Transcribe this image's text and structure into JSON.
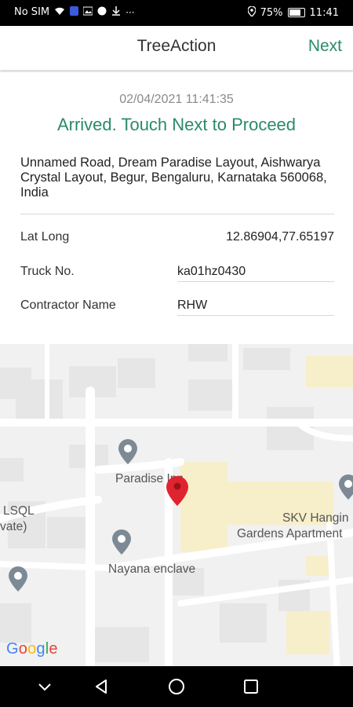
{
  "status_bar": {
    "carrier": "No SIM",
    "battery": "75%",
    "time": "11:41"
  },
  "app_bar": {
    "title": "TreeAction",
    "next_label": "Next"
  },
  "details": {
    "timestamp": "02/04/2021 11:41:35",
    "status_message": "Arrived. Touch Next to Proceed",
    "address": "Unnamed Road, Dream Paradise Layout, Aishwarya Crystal Layout, Begur, Bengaluru, Karnataka 560068, India",
    "fields": [
      {
        "label": "Lat Long",
        "value": "12.86904,77.65197"
      },
      {
        "label": "Truck No.",
        "value": "ka01hz0430"
      },
      {
        "label": "Contractor Name",
        "value": "RHW"
      }
    ]
  },
  "map": {
    "places": [
      "Paradise Inn",
      "SKV Hanging Gardens Apartment",
      "Nayana enclave",
      "LSQL (Private)"
    ],
    "place_lines": {
      "paradise": "Paradise Inn",
      "skv_line1": "SKV Hangin",
      "skv_line2": "Gardens Apartment",
      "nayana": "Nayana enclave",
      "lsql_line1": "LSQL",
      "lsql_line2": "vate)"
    },
    "attribution": "Google"
  },
  "colors": {
    "accent": "#2a8a6a",
    "marker": "#e0242f",
    "poi_pin": "#7d8a95"
  }
}
